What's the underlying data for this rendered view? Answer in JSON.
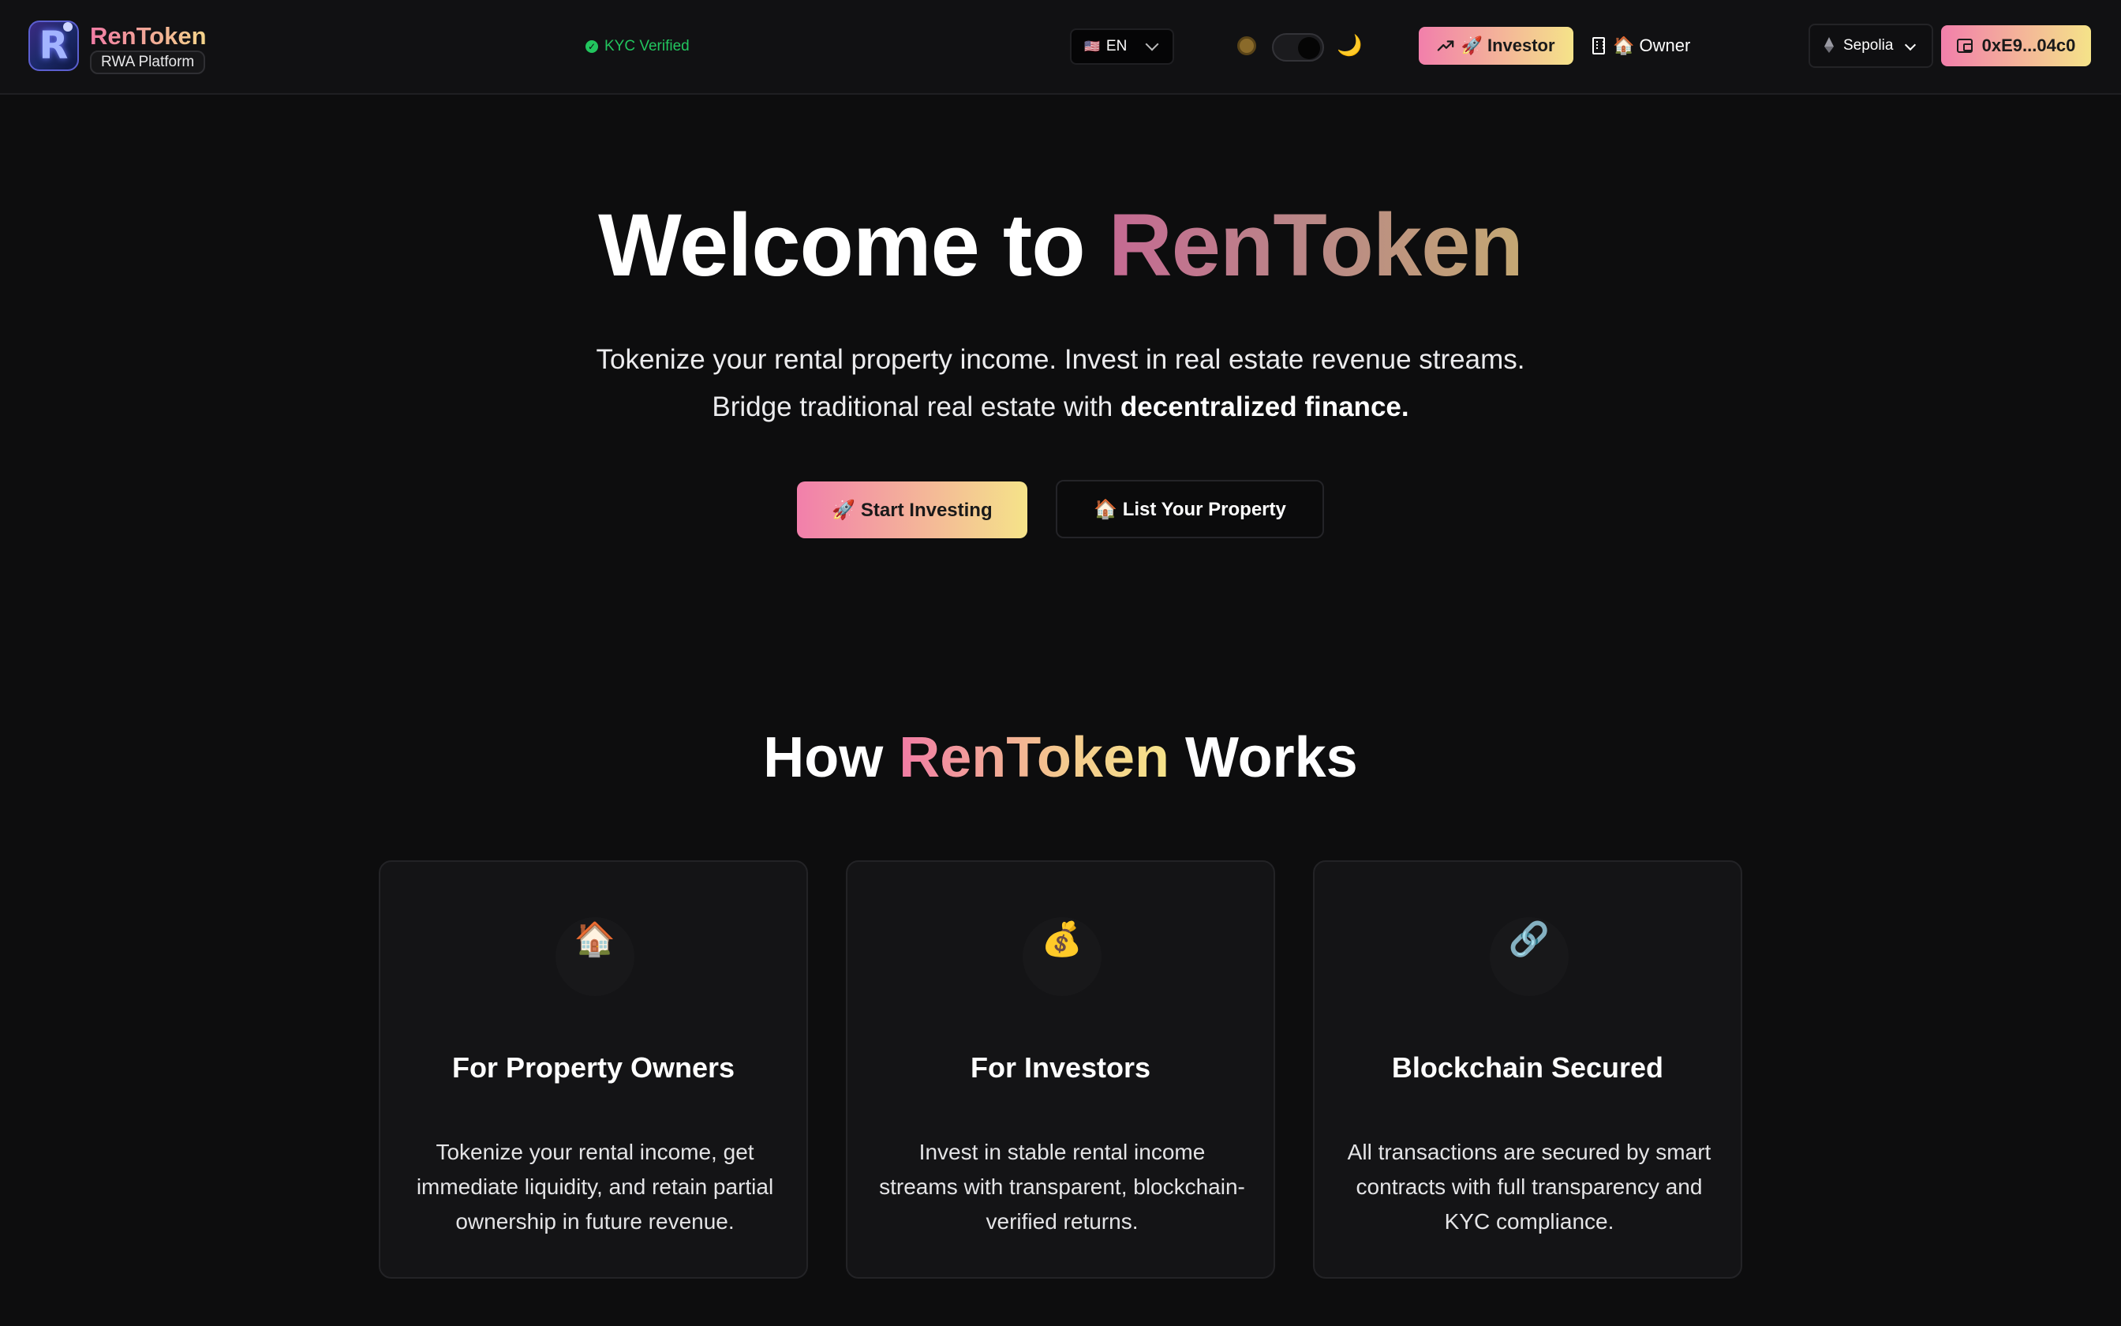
{
  "brand": {
    "name": "RenToken",
    "badge": "RWA Platform",
    "logo_letter": "R"
  },
  "header": {
    "kyc_status": "KYC Verified",
    "language": {
      "flag": "🇺🇸",
      "code": "EN"
    },
    "theme": {
      "light_icon": "sun-icon",
      "dark_icon": "🌙",
      "mode": "dark"
    },
    "roles": {
      "investor_label": "🚀 Investor",
      "owner_label": "🏠 Owner",
      "active": "investor"
    },
    "network": "Sepolia",
    "wallet_address": "0xE9...04c0"
  },
  "hero": {
    "title_prefix": "Welcome to",
    "title_accent": "RenToken",
    "subtitle_line1": "Tokenize your rental property income. Invest in real estate revenue streams.",
    "subtitle_line2_plain": "Bridge traditional real estate with",
    "subtitle_line2_bold": "decentralized finance.",
    "primary_cta": "🚀 Start Investing",
    "secondary_cta": "🏠 List Your Property"
  },
  "how_it_works": {
    "title_prefix": "How",
    "title_accent": "RenToken",
    "title_suffix": "Works",
    "cards": [
      {
        "icon": "🏠",
        "title": "For Property Owners",
        "description": "Tokenize your rental income, get immediate liquidity, and retain partial ownership in future revenue."
      },
      {
        "icon": "💰",
        "title": "For Investors",
        "description": "Invest in stable rental income streams with transparent, blockchain-verified returns."
      },
      {
        "icon": "🔗",
        "title": "Blockchain Secured",
        "description": "All transactions are secured by smart contracts with full transparency and KYC compliance."
      }
    ]
  },
  "colors": {
    "background": "#0d0d0e",
    "accent_gradient_start": "#f27fab",
    "accent_gradient_end": "#f5e389",
    "kyc_green": "#22c55e"
  }
}
